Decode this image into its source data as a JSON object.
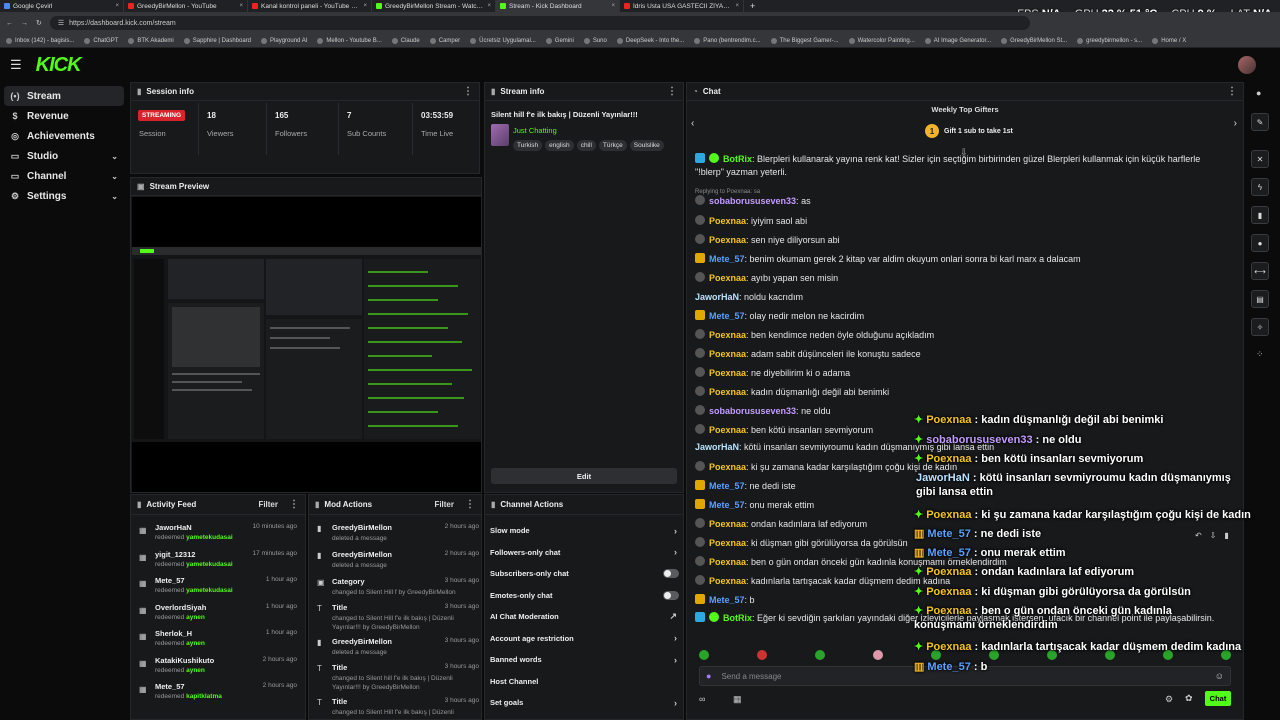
{
  "browser": {
    "tabs": [
      {
        "label": "Google Çevirl",
        "color": "#4a8af4"
      },
      {
        "label": "GreedyBirMellon - YouTube",
        "color": "#e22"
      },
      {
        "label": "Kanal kontrol paneli - YouTube Stu",
        "color": "#e22"
      },
      {
        "label": "GreedyBirMellon Stream - Watch Li",
        "color": "#53fc18"
      },
      {
        "label": "Stream - Kick Dashboard",
        "color": "#53fc18"
      },
      {
        "label": "İdris Usta USA GASTECII ZİYARETİ",
        "color": "#e22"
      }
    ],
    "url": "https://dashboard.kick.com/stream",
    "bookmarks": [
      "Inbox (142) - bagisis...",
      "ChatGPT",
      "BTK Akademi",
      "Sapphire | Dashboard",
      "Playground AI",
      "Mellon - Youtube B...",
      "Claude",
      "Camper",
      "Ücretsiz Uygulamal...",
      "Gemini",
      "Suno",
      "DeepSeek - Into the...",
      "Pano (bentrendim.c...",
      "The Biggest Gamer-...",
      "Watercolor Painting...",
      "AI Image Generator...",
      "GreedyBirMellon St...",
      "greedybirmellon - s...",
      "Home / X"
    ]
  },
  "osd": {
    "fps_k": "FPS",
    "fps_v": "N/A",
    "gpu_k": "GPU",
    "gpu_v": "22 % 51 °C",
    "cpu_k": "CPU",
    "cpu_v": "9 %",
    "lat_k": "LAT",
    "lat_v": "N/A"
  },
  "app": {
    "logo": "KICK"
  },
  "sidebar": {
    "items": [
      {
        "label": "Stream",
        "icon": "(•)"
      },
      {
        "label": "Revenue",
        "icon": "$"
      },
      {
        "label": "Achievements",
        "icon": "◎"
      },
      {
        "label": "Studio",
        "icon": "▭"
      },
      {
        "label": "Channel",
        "icon": "▭"
      },
      {
        "label": "Settings",
        "icon": "⚙"
      }
    ]
  },
  "session": {
    "title": "Session info",
    "status": "STREAMING",
    "status_label": "Session",
    "viewers": "18",
    "viewers_label": "Viewers",
    "followers": "165",
    "followers_label": "Followers",
    "subs": "7",
    "subs_label": "Sub Counts",
    "time": "03:53:59",
    "time_label": "Time Live"
  },
  "stream_info": {
    "title": "Stream info",
    "stream_title": "Silent hill f'e ilk bakış | Düzenli Yayınlar!!!",
    "category": "Just Chatting",
    "tags": [
      "Turkish",
      "english",
      "chill",
      "Türkçe",
      "Soulslike"
    ],
    "edit": "Edit"
  },
  "preview": {
    "title": "Stream Preview"
  },
  "activity": {
    "title": "Activity Feed",
    "filter": "Filter",
    "items": [
      {
        "name": "JaworHaN",
        "action": "redeemed",
        "reward": "yametekudasai",
        "time": "10 minutes ago"
      },
      {
        "name": "yigit_12312",
        "action": "redeemed",
        "reward": "yametekudasai",
        "time": "17 minutes ago"
      },
      {
        "name": "Mete_57",
        "action": "redeemed",
        "reward": "yametekudasai",
        "time": "1 hour ago"
      },
      {
        "name": "OverlordSiyah",
        "action": "redeemed",
        "reward": "aynen",
        "time": "1 hour ago"
      },
      {
        "name": "Sherlok_H",
        "action": "redeemed",
        "reward": "aynen",
        "time": "1 hour ago"
      },
      {
        "name": "KatakiKushikuto",
        "action": "redeemed",
        "reward": "aynen",
        "time": "2 hours ago"
      },
      {
        "name": "Mete_57",
        "action": "redeemed",
        "reward": "kapitklatma",
        "time": "2 hours ago"
      }
    ]
  },
  "mod": {
    "title": "Mod Actions",
    "filter": "Filter",
    "items": [
      {
        "name": "GreedyBirMellon",
        "desc": "deleted a message",
        "time": "2 hours ago"
      },
      {
        "name": "GreedyBirMellon",
        "desc": "deleted a message",
        "time": "2 hours ago"
      },
      {
        "name": "Category",
        "desc": "changed to Silent Hill f by GreedyBirMellon",
        "time": "3 hours ago"
      },
      {
        "name": "Title",
        "desc": "changed to Silent Hill f'e ilk bakış | Düzenli Yayınlar!!! by GreedyBirMellon",
        "time": "3 hours ago"
      },
      {
        "name": "GreedyBirMellon",
        "desc": "deleted a message",
        "time": "3 hours ago"
      },
      {
        "name": "Title",
        "desc": "changed to Silent hill f'e ilk bakış | Düzenli Yayınlar!!! by GreedyBirMellon",
        "time": "3 hours ago"
      },
      {
        "name": "Title",
        "desc": "changed to Silent Hill f'e ilk bakış | Düzenli",
        "time": "3 hours ago"
      }
    ]
  },
  "channel_actions": {
    "title": "Channel Actions",
    "items": [
      "Slow mode",
      "Followers-only chat",
      "Subscribers-only chat",
      "Emotes-only chat",
      "AI Chat Moderation",
      "Account age restriction",
      "Banned words",
      "Host Channel",
      "Set goals"
    ]
  },
  "chat": {
    "title": "Chat",
    "gifters_title": "Weekly Top Gifters",
    "gifters_cta": "Gift 1 sub to take 1st",
    "gifters_rank": "1",
    "reply_note": "Replying to Poexnaa: sa",
    "messages": [
      {
        "user": "BotRix",
        "color": "#53fc18",
        "badge": "bot",
        "text": "Blerpleri kullanarak yayına renk kat! Sizler için seçtiğim birbirinden güzel Blerpleri kullanmak için küçük harflerle \"!blerp\" yazman yeterli."
      },
      {
        "user": "sobaborususeven33",
        "color": "#c49cff",
        "badge": "dot",
        "text": "as"
      },
      {
        "user": "Poexnaa",
        "color": "#f5c518",
        "badge": "dot",
        "text": "iyiyim saol abi"
      },
      {
        "user": "Poexnaa",
        "color": "#f5c518",
        "badge": "dot",
        "text": "sen niye diliyorsun abi"
      },
      {
        "user": "Mete_57",
        "color": "#5aa0ff",
        "badge": "crown",
        "text": "benim okumam gerek 2 kitap var aldim okuyum onlari sonra bi karl marx a dalacam"
      },
      {
        "user": "Poexnaa",
        "color": "#f5c518",
        "badge": "dot",
        "text": "ayıbı yapan sen misin"
      },
      {
        "user": "JaworHaN",
        "color": "#b7e3ff",
        "badge": "",
        "text": "noldu kacrıdım"
      },
      {
        "user": "Mete_57",
        "color": "#5aa0ff",
        "badge": "crown",
        "text": "olay nedir melon ne kacirdim"
      },
      {
        "user": "Poexnaa",
        "color": "#f5c518",
        "badge": "dot",
        "text": "ben kendimce neden öyle olduğunu açıkladım"
      },
      {
        "user": "Poexnaa",
        "color": "#f5c518",
        "badge": "dot",
        "text": "adam sabit düşünceleri ile konuştu sadece"
      },
      {
        "user": "Poexnaa",
        "color": "#f5c518",
        "badge": "dot",
        "text": "ne diyebilirim ki o adama"
      },
      {
        "user": "Poexnaa",
        "color": "#f5c518",
        "badge": "dot",
        "text": "kadın düşmanlığı değil abi benimki"
      },
      {
        "user": "sobaborususeven33",
        "color": "#c49cff",
        "badge": "dot",
        "text": "ne oldu"
      },
      {
        "user": "Poexnaa",
        "color": "#f5c518",
        "badge": "dot",
        "text": "ben kötü insanları sevmiyorum"
      },
      {
        "user": "JaworHaN",
        "color": "#b7e3ff",
        "badge": "",
        "text": "kötü insanları sevmiyroumu kadın düşmanıymış gibi lansa ettin"
      },
      {
        "user": "Poexnaa",
        "color": "#f5c518",
        "badge": "dot",
        "text": "ki şu zamana kadar karşılaştığım çoğu kişi de kadın"
      },
      {
        "user": "Mete_57",
        "color": "#5aa0ff",
        "badge": "crown",
        "text": "ne dedi iste"
      },
      {
        "user": "Mete_57",
        "color": "#5aa0ff",
        "badge": "crown",
        "text": "onu merak ettim"
      },
      {
        "user": "Poexnaa",
        "color": "#f5c518",
        "badge": "dot",
        "text": "ondan kadınlara laf ediyorum"
      },
      {
        "user": "Poexnaa",
        "color": "#f5c518",
        "badge": "dot",
        "text": "ki düşman gibi görülüyorsa da görülsün"
      },
      {
        "user": "Poexnaa",
        "color": "#f5c518",
        "badge": "dot",
        "text": "ben o gün ondan önceki gün kadınla konuşmamı örneklendirdim"
      },
      {
        "user": "Poexnaa",
        "color": "#f5c518",
        "badge": "dot",
        "text": "kadınlarla tartışacak kadar düşmem dedim kadına"
      },
      {
        "user": "Mete_57",
        "color": "#5aa0ff",
        "badge": "crown",
        "text": "b"
      },
      {
        "user": "BotRix",
        "color": "#53fc18",
        "badge": "bot",
        "text": "Eğer ki sevdiğin şarkıları yayındaki diğer izleyicilerle paylaşmak istersen, ufacık bir channel point ile paylaşabilirsin."
      }
    ],
    "overlay": [
      {
        "user": "Poexnaa",
        "color": "#f5c518",
        "text": "kadın düşmanlığı değil abi benimki"
      },
      {
        "user": "sobaborususeven33",
        "color": "#c49cff",
        "text": "ne oldu"
      },
      {
        "user": "Poexnaa",
        "color": "#f5c518",
        "text": "ben kötü insanları sevmiyorum"
      },
      {
        "user": "JaworHaN",
        "color": "#b7e3ff",
        "text": "kötü insanları sevmiyroumu kadın düşmanıymış gibi lansa ettin"
      },
      {
        "user": "Poexnaa",
        "color": "#f5c518",
        "text": "ki şu zamana kadar karşılaştığım çoğu kişi de kadın"
      },
      {
        "user": "Mete_57",
        "color": "#5aa0ff",
        "text": "ne dedi iste"
      },
      {
        "user": "Mete_57",
        "color": "#5aa0ff",
        "text": "onu merak ettim"
      },
      {
        "user": "Poexnaa",
        "color": "#f5c518",
        "text": "ondan kadınlara laf ediyorum"
      },
      {
        "user": "Poexnaa",
        "color": "#f5c518",
        "text": "ki düşman gibi görülüyorsa da görülsün"
      },
      {
        "user": "Poexnaa",
        "color": "#f5c518",
        "text": "ben o gün ondan önceki gün kadınla konuşmamı örneklendirdim"
      },
      {
        "user": "Poexnaa",
        "color": "#f5c518",
        "text": "kadınlarla tartışacak kadar düşmem dedim kadına"
      },
      {
        "user": "Mete_57",
        "color": "#5aa0ff",
        "text": "b"
      }
    ],
    "input_placeholder": "Send a message",
    "send": "Chat"
  },
  "colors": {
    "accent": "#53fc18",
    "live": "#d8232a"
  }
}
